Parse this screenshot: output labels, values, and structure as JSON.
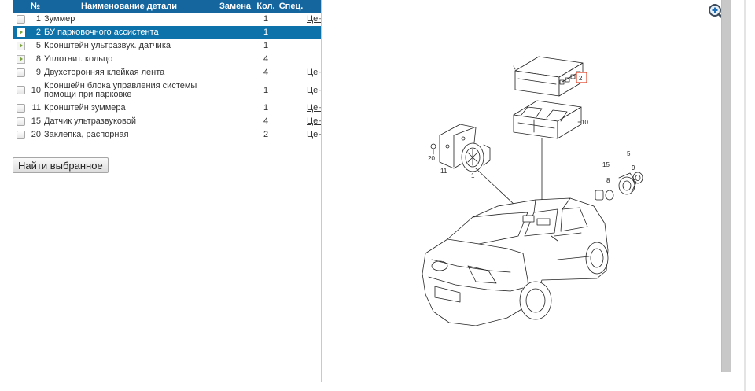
{
  "table": {
    "headers": {
      "num": "№",
      "name": "Наименование детали",
      "replace": "Замена",
      "qty": "Кол.",
      "spec": "Спец."
    },
    "rows": [
      {
        "num": "1",
        "name": "Зуммер",
        "qty": "1",
        "price": "Цена",
        "control": "checkbox"
      },
      {
        "num": "2",
        "name": "БУ парковочного ассистента",
        "qty": "1",
        "price": "",
        "control": "expander",
        "selected": true
      },
      {
        "num": "5",
        "name": "Кронштейн ультразвук. датчика",
        "qty": "1",
        "price": "",
        "control": "expander"
      },
      {
        "num": "8",
        "name": "Уплотнит. кольцо",
        "qty": "4",
        "price": "",
        "control": "expander"
      },
      {
        "num": "9",
        "name": "Двухсторонняя клейкая лента",
        "qty": "4",
        "price": "Цена",
        "control": "checkbox"
      },
      {
        "num": "10",
        "name": "Кроншейн блока управления системы помощи при парковке",
        "qty": "1",
        "price": "Цена",
        "control": "checkbox"
      },
      {
        "num": "11",
        "name": "Кронштейн зуммера",
        "qty": "1",
        "price": "Цена",
        "control": "checkbox"
      },
      {
        "num": "15",
        "name": "Датчик ультразвуковой",
        "qty": "4",
        "price": "Цена",
        "control": "checkbox"
      },
      {
        "num": "20",
        "name": "Заклепка, распорная",
        "qty": "2",
        "price": "Цена",
        "control": "checkbox"
      }
    ]
  },
  "find_button": {
    "label": "Найти выбранное"
  },
  "diagram": {
    "callouts": [
      "2",
      "10",
      "20",
      "11",
      "1",
      "15",
      "8",
      "5",
      "9"
    ],
    "highlighted_callout": "2",
    "highlight_color": "#e0452b",
    "icons": {
      "zoom": "zoom-in-icon"
    }
  },
  "colors": {
    "header": "#15669f",
    "selected_row": "#0e72aa"
  }
}
